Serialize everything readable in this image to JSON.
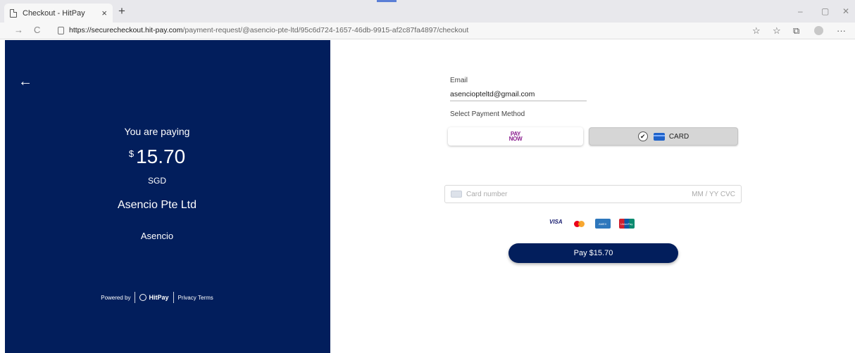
{
  "browser": {
    "tab_title": "Checkout - HitPay",
    "tab_close": "×",
    "new_tab": "+",
    "url_host": "https://securecheckout.hit-pay.com",
    "url_path": "/payment-request/@asencio-pte-ltd/95c6d724-1657-46db-9915-af2c87fa4897/checkout",
    "minimize": "–",
    "restore": "▢",
    "close": "✕",
    "back": "→",
    "refresh": "C",
    "more": "···"
  },
  "summary": {
    "back_arrow": "←",
    "paying_label": "You are paying",
    "currency_symbol": "$",
    "amount": "15.70",
    "currency": "SGD",
    "merchant": "Asencio Pte Ltd",
    "store": "Asencio"
  },
  "footer": {
    "powered_by": "Powered by",
    "brand": "HitPay",
    "privacy": "Privacy",
    "terms": "Terms"
  },
  "form": {
    "email_label": "Email",
    "email_value": "asenciopteltd@gmail.com",
    "method_label": "Select Payment Method",
    "paynow_top": "PAY",
    "paynow_bottom": "NOW",
    "card_label": "CARD",
    "check": "✔",
    "card_placeholder": "Card number",
    "expiry_cvc": "MM / YY  CVC",
    "pay_button": "Pay $15.70"
  },
  "brands": {
    "visa": "VISA",
    "amex": "AMEX",
    "unionpay": "UnionPay"
  },
  "colors": {
    "primary": "#021e5c",
    "paynow": "#8a1d8e"
  }
}
